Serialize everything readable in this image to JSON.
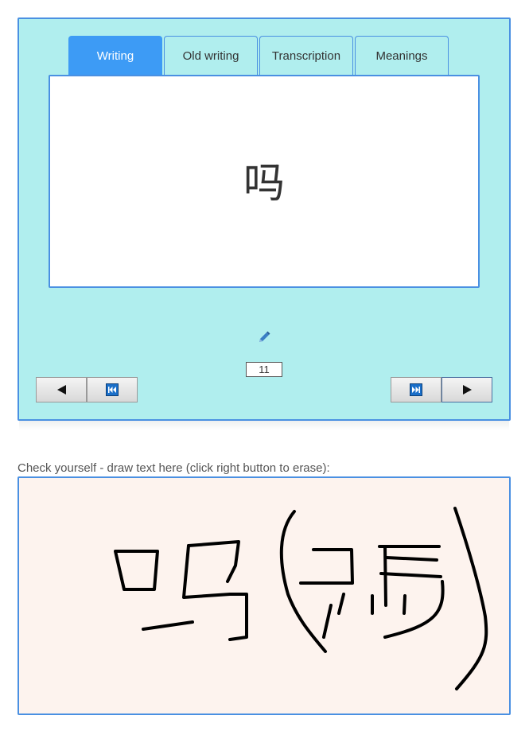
{
  "tabs": [
    {
      "label": "Writing",
      "active": true
    },
    {
      "label": "Old writing",
      "active": false
    },
    {
      "label": "Transcription",
      "active": false
    },
    {
      "label": "Meanings",
      "active": false
    }
  ],
  "card": {
    "character": "吗",
    "counter": "11"
  },
  "icons": {
    "edit": "pencil-icon",
    "prev": "triangle-left-icon",
    "first": "skip-to-start-icon",
    "last": "skip-to-end-icon",
    "next": "triangle-right-icon"
  },
  "drawing": {
    "label": "Check yourself - draw text here (click right button to erase):"
  },
  "colors": {
    "panel_bg": "#b0eeee",
    "accent": "#3d9bf5",
    "border": "#4a90e2",
    "canvas_bg": "#fdf3ee"
  }
}
